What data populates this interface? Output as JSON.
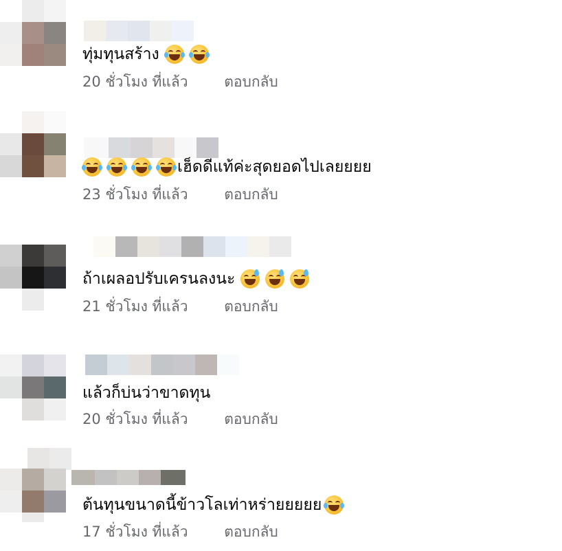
{
  "comments": [
    {
      "text": "ทุ่มทุนสร้าง",
      "emojis_after": [
        "tears-of-joy-emoji",
        "tears-of-joy-emoji"
      ],
      "emojis_before": [],
      "time": "20 ชั่วโมง ที่แล้ว",
      "reply": "ตอบกลับ"
    },
    {
      "text": "เฮ็ดดีแท้ค่ะสุดยอดไปเลยยยย",
      "emojis_before": [
        "tears-of-joy-emoji",
        "tears-of-joy-emoji",
        "tears-of-joy-emoji",
        "tears-of-joy-emoji"
      ],
      "emojis_after": [],
      "time": "23 ชั่วโมง ที่แล้ว",
      "reply": "ตอบกลับ"
    },
    {
      "text": "ถ้าเผลอปรับเครนลงนะ",
      "emojis_after": [
        "sweat-smile-emoji",
        "sweat-smile-emoji",
        "sweat-smile-emoji"
      ],
      "emojis_before": [],
      "time": "21 ชั่วโมง ที่แล้ว",
      "reply": "ตอบกลับ"
    },
    {
      "text": "แล้วก็บ่นว่าขาดทุน",
      "emojis_after": [],
      "emojis_before": [],
      "time": "20 ชั่วโมง ที่แล้ว",
      "reply": "ตอบกลับ"
    },
    {
      "text": "ต้นทุนขนาดนี้ข้าวโลเท่าหร่ายยยยย",
      "emojis_after": [
        "tears-of-joy-emoji"
      ],
      "emojis_before": [],
      "time": "17 ชั่วโมง ที่แล้ว",
      "reply": "ตอบกลับ"
    }
  ],
  "colors": {
    "text": "#050505",
    "meta": "#65676b",
    "background": "#ffffff"
  }
}
